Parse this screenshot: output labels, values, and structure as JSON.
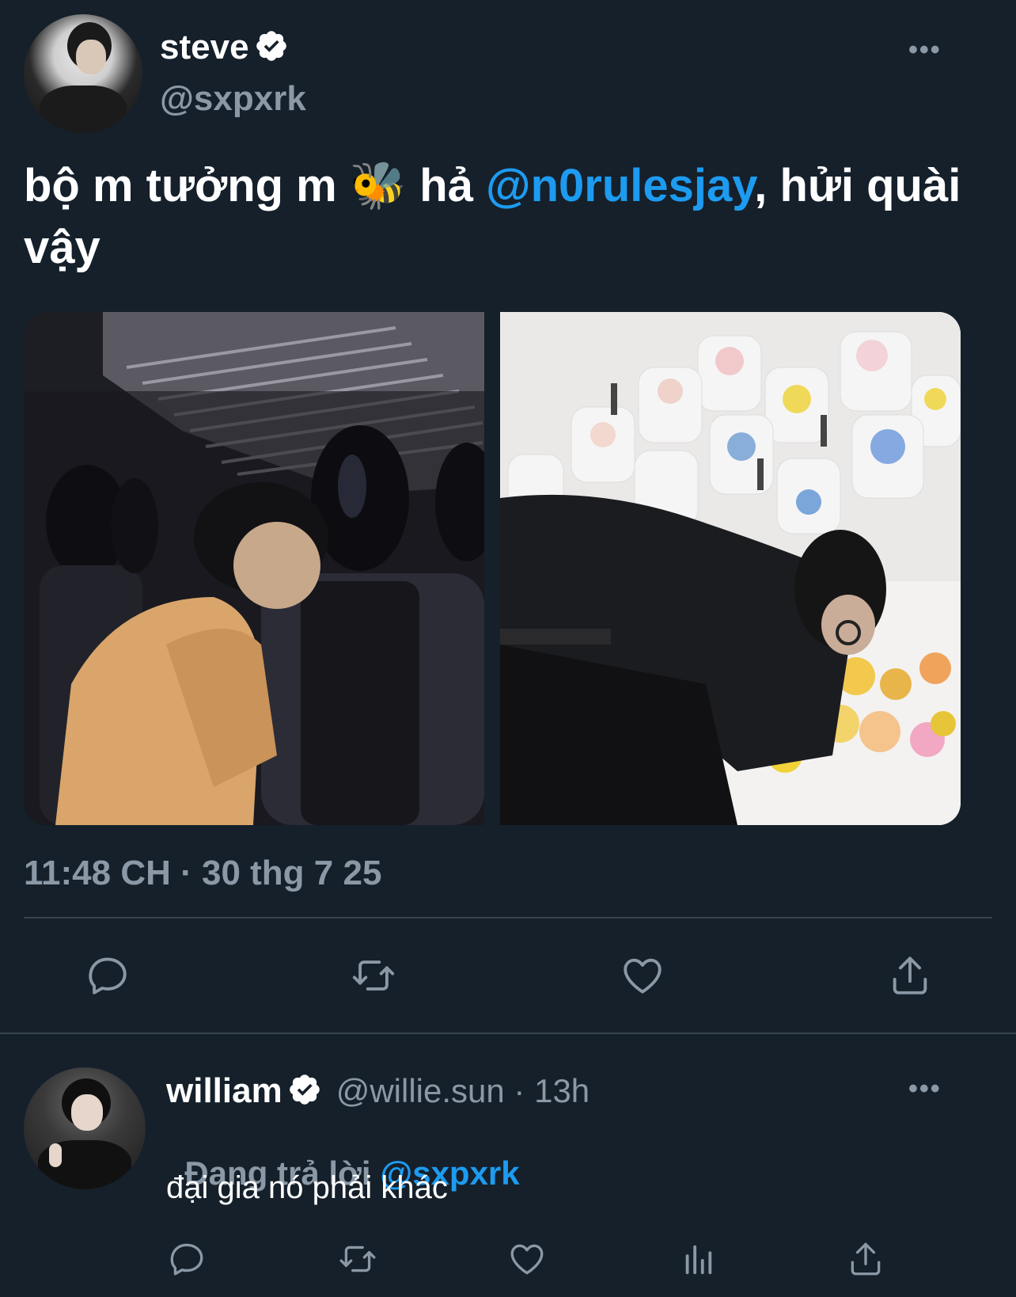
{
  "tweet": {
    "author_name": "steve",
    "author_handle": "@sxpxrk",
    "text_part1": "bộ m tưởng m ",
    "text_emoji": "🐝",
    "text_part2": " hả ",
    "mention": "@n0rulesjay",
    "text_part3": ", hửi quài vậy",
    "timestamp": "11:48 CH · 30 thg 7 25",
    "more_icon": "more-horizontal-icon",
    "verified_icon": "verified-badge-icon"
  },
  "actions": {
    "icons": [
      "reply-icon",
      "retweet-icon",
      "like-icon",
      "share-icon"
    ]
  },
  "reply": {
    "author_name": "william",
    "author_handle": "@willie.sun",
    "time_sep": " · ",
    "time": "13h",
    "replying_label": "Đang trả lời ",
    "replying_to": "@sxpxrk",
    "text": "đại gia nó phải khác",
    "icons": [
      "reply-icon",
      "retweet-icon",
      "like-icon",
      "analytics-icon",
      "share-icon"
    ]
  },
  "colors": {
    "background": "#15202b",
    "accent": "#1d9bf0",
    "muted": "#8b98a5",
    "divider": "#38444d"
  }
}
